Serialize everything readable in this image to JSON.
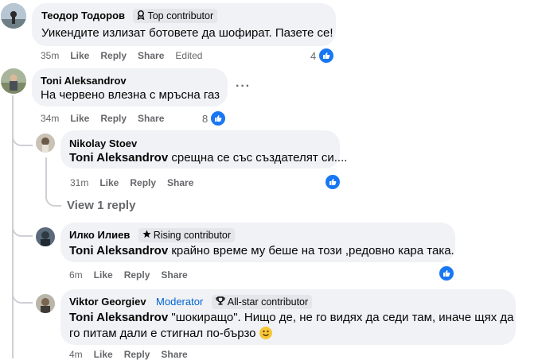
{
  "comments": [
    {
      "author": "Теодор Тодоров",
      "badge": "Top contributor",
      "text": "Уикендите излизат ботовете да шофират. Пазете се!",
      "time": "35m",
      "like": "Like",
      "reply": "Reply",
      "share": "Share",
      "edited": "Edited",
      "reactions": "4"
    },
    {
      "author": "Toni Aleksandrov",
      "text": "На червено влезна с мръсна газ",
      "time": "34m",
      "like": "Like",
      "reply": "Reply",
      "share": "Share",
      "reactions": "8",
      "more": "···"
    },
    {
      "author": "Nikolay Stoev",
      "mention": "Toni Aleksandrov",
      "text": " срещна се със създателят си....",
      "time": "31m",
      "like": "Like",
      "reply": "Reply",
      "share": "Share"
    },
    {
      "author": "Илко Илиев",
      "badge": "Rising contributor",
      "mention": "Toni Aleksandrov",
      "text": " крайно време му беше на този ,редовно кара така.",
      "time": "6m",
      "like": "Like",
      "reply": "Reply",
      "share": "Share"
    },
    {
      "author": "Viktor Georgiev",
      "role": "Moderator",
      "badge": "All-star contributor",
      "mention": "Toni Aleksandrov",
      "text_line1": " \"шокиращо\". Нищо де, не го видях да седи там, иначе щях да",
      "text_line2": "го питам дали е стигнал по-бързо",
      "time": "4m",
      "like": "Like",
      "reply": "Reply",
      "share": "Share"
    }
  ],
  "view_replies": "View 1 reply",
  "colors": {
    "link": "#0064d1",
    "bubble": "#f0f2f5",
    "like_blue": "#1877f2",
    "muted": "#65676b"
  }
}
